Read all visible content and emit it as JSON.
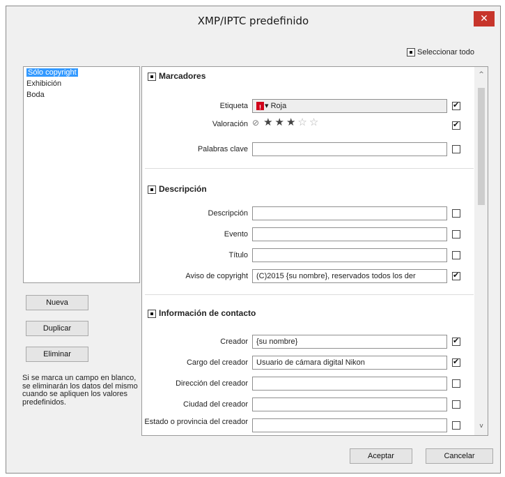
{
  "window": {
    "title": "XMP/IPTC predefinido",
    "close": "✕"
  },
  "select_all": {
    "label": "Seleccionar todo",
    "checked": true
  },
  "presets": {
    "items": [
      "Sólo copyright",
      "Exhibición",
      "Boda"
    ],
    "selected_index": 0
  },
  "buttons": {
    "new": "Nueva",
    "duplicate": "Duplicar",
    "delete": "Eliminar",
    "accept": "Aceptar",
    "cancel": "Cancelar"
  },
  "hint": "Si se marca un campo en blanco, se eliminarán los datos del mismo cuando se apliquen los valores predefinidos.",
  "sections": {
    "markers": {
      "title": "Marcadores",
      "label_field": {
        "label": "Etiqueta",
        "value": "▾ Roja",
        "color": "#d0021b",
        "checked": true
      },
      "rating": {
        "label": "Valoración",
        "stars_filled": 3,
        "stars_total": 5,
        "checked": true
      },
      "keywords": {
        "label": "Palabras clave",
        "value": "",
        "checked": false
      }
    },
    "description": {
      "title": "Descripción",
      "description": {
        "label": "Descripción",
        "value": "",
        "checked": false
      },
      "event": {
        "label": "Evento",
        "value": "",
        "checked": false
      },
      "title_field": {
        "label": "Título",
        "value": "",
        "checked": false
      },
      "copyright": {
        "label": "Aviso de copyright",
        "value": "(C)2015 {su nombre}, reservados todos los der",
        "checked": true
      }
    },
    "contact": {
      "title": "Información de contacto",
      "creator": {
        "label": "Creador",
        "value": "{su nombre}",
        "checked": true
      },
      "creator_job": {
        "label": "Cargo del creador",
        "value": "Usuario de cámara digital Nikon",
        "checked": true
      },
      "creator_address": {
        "label": "Dirección del creador",
        "value": "",
        "checked": false
      },
      "creator_city": {
        "label": "Ciudad del creador",
        "value": "",
        "checked": false
      },
      "creator_state": {
        "label": "Estado o provincia del creador",
        "value": "",
        "checked": false
      }
    }
  },
  "scrollbar": {
    "up": "^",
    "down": "v"
  },
  "icons": {
    "clear_rating": "clear-rating-icon",
    "star_filled": "★",
    "star_empty": "☆"
  }
}
